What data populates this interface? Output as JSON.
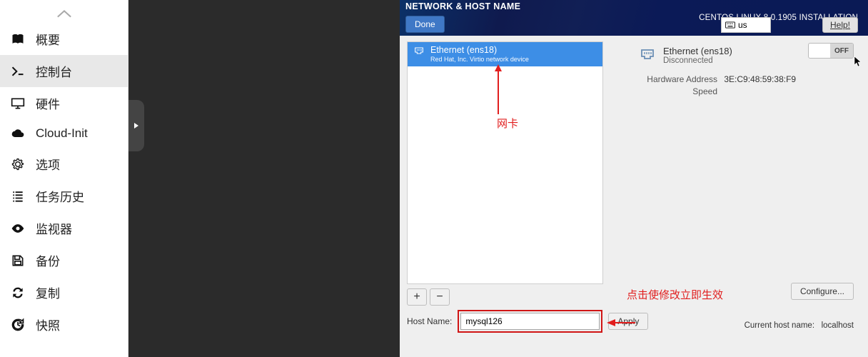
{
  "sidebar": {
    "items": [
      {
        "label": "概要",
        "icon": "book"
      },
      {
        "label": "控制台",
        "icon": "terminal"
      },
      {
        "label": "硬件",
        "icon": "monitor"
      },
      {
        "label": "Cloud-Init",
        "icon": "cloud"
      },
      {
        "label": "选项",
        "icon": "gear"
      },
      {
        "label": "任务历史",
        "icon": "list"
      },
      {
        "label": "监视器",
        "icon": "eye"
      },
      {
        "label": "备份",
        "icon": "save"
      },
      {
        "label": "复制",
        "icon": "refresh"
      },
      {
        "label": "快照",
        "icon": "history"
      }
    ],
    "selected_index": 1
  },
  "installer": {
    "header": {
      "title": "NETWORK & HOST NAME",
      "done_label": "Done",
      "version": "CENTOS LINUX 8.0.1905 INSTALLATION",
      "kbd_layout": "us",
      "help_label": "Help!"
    },
    "nic_list": [
      {
        "name": "Ethernet (ens18)",
        "subtitle": "Red Hat, Inc. Virtio network device"
      }
    ],
    "nic_buttons": {
      "add": "+",
      "remove": "−"
    },
    "details": {
      "name": "Ethernet (ens18)",
      "status": "Disconnected",
      "hw_label": "Hardware Address",
      "hw_value": "3E:C9:48:59:38:F9",
      "speed_label": "Speed",
      "speed_value": ""
    },
    "toggle": {
      "state": "OFF"
    },
    "configure_label": "Configure...",
    "host": {
      "label": "Host Name:",
      "value": "mysql126",
      "apply_label": "Apply",
      "current_label": "Current host name:",
      "current_value": "localhost"
    }
  },
  "annotations": {
    "nic": "网卡",
    "apply": "点击使修改立即生效"
  }
}
